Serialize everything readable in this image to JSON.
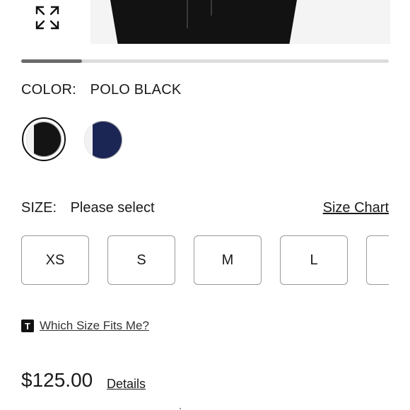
{
  "hero": {
    "expand_icon": "expand-arrows-icon"
  },
  "gallery": {
    "progress_fraction": 0.165
  },
  "color": {
    "label": "COLOR:",
    "selected_name": "POLO BLACK",
    "swatches": [
      {
        "name": "POLO BLACK",
        "hex": "#141414",
        "selected": true
      },
      {
        "name": "",
        "hex": "#1b2655",
        "selected": false
      }
    ]
  },
  "size": {
    "label": "SIZE:",
    "value": "Please select",
    "chart_link": "Size Chart",
    "options": [
      "XS",
      "S",
      "M",
      "L",
      ""
    ]
  },
  "fit": {
    "icon": "t-brand-icon",
    "icon_letter": "T",
    "link": "Which Size Fits Me?"
  },
  "purchase": {
    "price": "$125.00",
    "details_link": "Details"
  }
}
